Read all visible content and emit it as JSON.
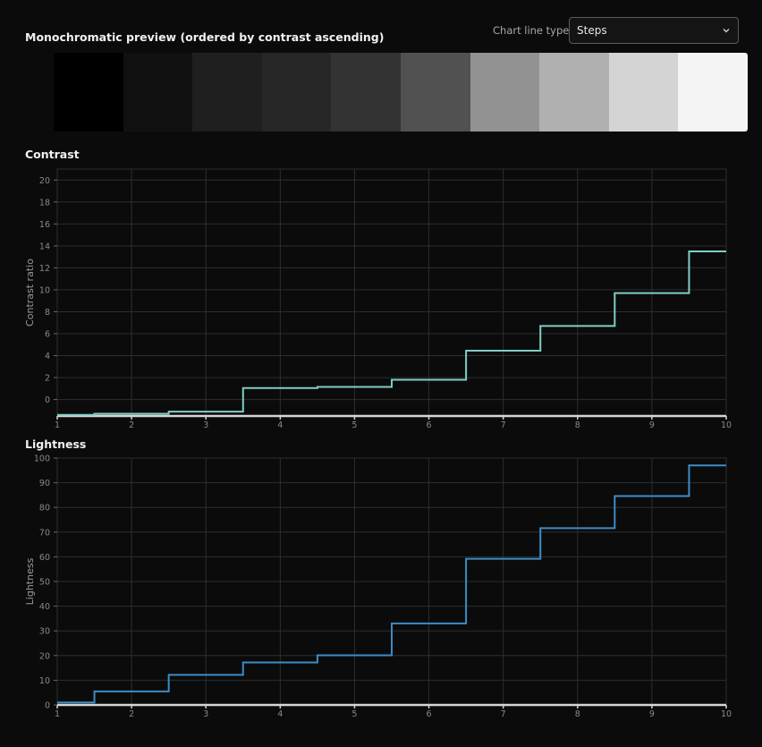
{
  "preview": {
    "title": "Monochromatic preview (ordered by contrast ascending)",
    "swatches": [
      "#000000",
      "#111111",
      "#1f1f1f",
      "#272727",
      "#333333",
      "#515151",
      "#929292",
      "#b0b0b0",
      "#d4d4d4",
      "#f4f4f4"
    ]
  },
  "controls": {
    "line_type_label": "Chart line type",
    "line_type_value": "Steps",
    "chevron_icon": "chevron-down-icon"
  },
  "chart_data": [
    {
      "type": "line",
      "line_style": "steps",
      "title": "Contrast",
      "ylabel": "Contrast ratio",
      "xlabel": "",
      "x": [
        1,
        2,
        3,
        4,
        5,
        6,
        7,
        8,
        9,
        10
      ],
      "values": [
        -1.4,
        -1.3,
        -1.1,
        1.05,
        1.15,
        1.8,
        4.45,
        6.7,
        9.7,
        13.5
      ],
      "xlim": [
        1,
        10
      ],
      "ylim": [
        -1.5,
        21
      ],
      "y_ticks": [
        0,
        2,
        4,
        6,
        8,
        10,
        12,
        14,
        16,
        18,
        20
      ],
      "x_ticks": [
        1,
        2,
        3,
        4,
        5,
        6,
        7,
        8,
        9,
        10
      ],
      "grid": true,
      "line_color": "#7ecfc4"
    },
    {
      "type": "line",
      "line_style": "steps",
      "title": "Lightness",
      "ylabel": "Lightness",
      "xlabel": "",
      "x": [
        1,
        2,
        3,
        4,
        5,
        6,
        7,
        8,
        9,
        10
      ],
      "values": [
        1,
        5.5,
        12.2,
        17.2,
        20.1,
        33,
        59.2,
        71.6,
        84.6,
        97
      ],
      "xlim": [
        1,
        10
      ],
      "ylim": [
        0,
        100
      ],
      "y_ticks": [
        0,
        10,
        20,
        30,
        40,
        50,
        60,
        70,
        80,
        90,
        100
      ],
      "x_ticks": [
        1,
        2,
        3,
        4,
        5,
        6,
        7,
        8,
        9,
        10
      ],
      "grid": true,
      "line_color": "#3d8cc7"
    }
  ]
}
